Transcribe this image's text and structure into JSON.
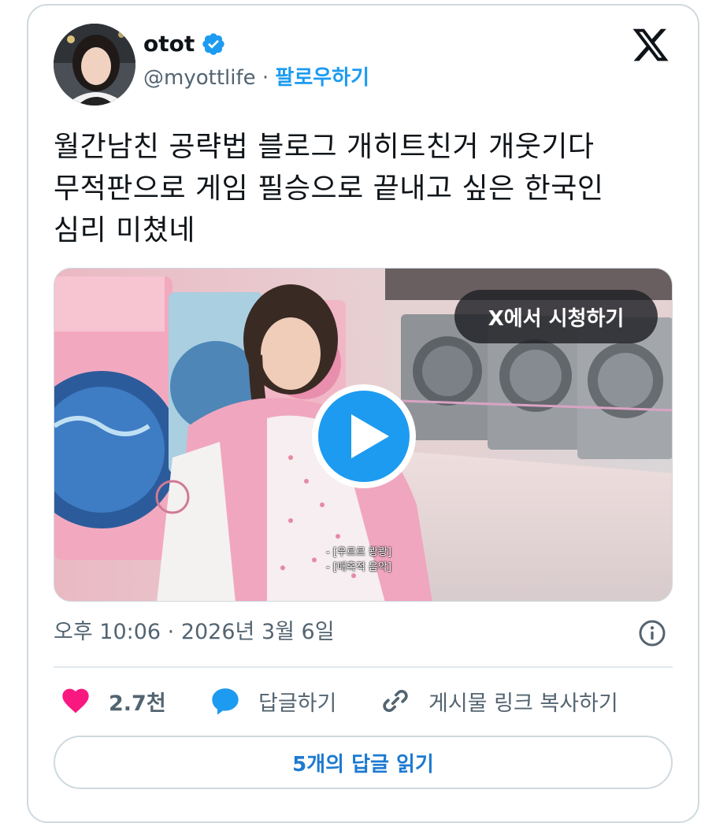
{
  "tweet": {
    "author_name": "otot",
    "handle": "@myottlife",
    "separator": " · ",
    "follow_label": "팔로우하기",
    "text_lines": [
      "월간남친 공략법 블로그 개히트친거 개웃기다",
      "무적판으로 게임 필승으로 끝내고 싶은 한국인",
      "심리 미쳤네"
    ],
    "timestamp": "오후 10:06 · 2026년 3월 6일"
  },
  "media": {
    "watch_label": "X에서 시청하기",
    "caption_lines": [
      "- [우르르 쾅쾅]",
      "- [매혹적 음악]"
    ]
  },
  "actions": {
    "like_count": "2.7천",
    "reply_label": "답글하기",
    "share_label": "게시물 링크 복사하기",
    "read_replies_label": "5개의 답글 읽기"
  },
  "icons": {
    "verified": "verified-badge-icon",
    "logo": "x-logo-icon",
    "play": "play-icon",
    "info": "info-icon",
    "like": "heart-icon",
    "reply": "speech-bubble-icon",
    "share": "link-icon"
  },
  "colors": {
    "accent": "#1d9bf0",
    "like": "#f91880",
    "text": "#0f1419",
    "muted": "#536471",
    "border": "#cfd9de"
  }
}
